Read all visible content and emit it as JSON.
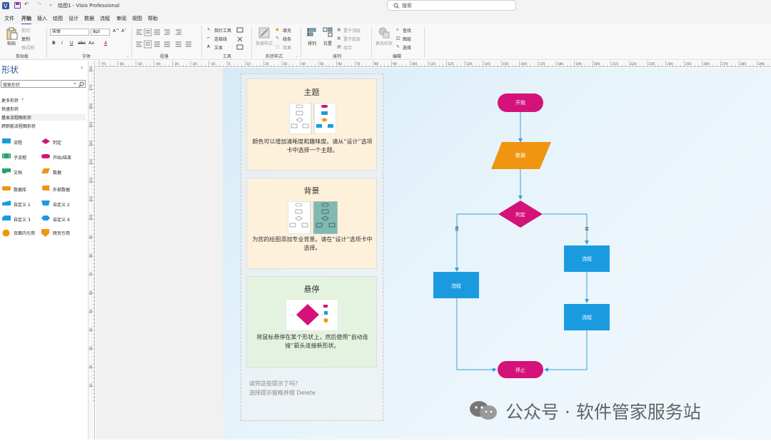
{
  "titlebar": {
    "title": "绘图1 - Visio Professional",
    "search_placeholder": "搜索"
  },
  "menu": {
    "tabs": [
      "文件",
      "开始",
      "插入",
      "绘图",
      "设计",
      "数据",
      "流程",
      "审阅",
      "视图",
      "帮助"
    ],
    "active_index": 1
  },
  "ribbon": {
    "clipboard": {
      "paste": "粘贴",
      "cut": "剪切",
      "copy": "复制",
      "format_painter": "格式刷",
      "group": "剪贴板"
    },
    "font": {
      "name": "宋体",
      "size": "8pt",
      "grow": "A^",
      "shrink": "A˅",
      "bold": "B",
      "italic": "I",
      "underline": "U",
      "strike": "abc",
      "case": "Aa",
      "color": "A",
      "group": "字体"
    },
    "paragraph": {
      "group": "段落"
    },
    "tools": {
      "pointer": "指针工具",
      "connector": "连接线",
      "text": "文本",
      "group": "工具"
    },
    "shape_styles": {
      "quick_styles": "快速样式",
      "fill": "填充",
      "line": "线条",
      "effects": "效果",
      "group": "形状样式"
    },
    "arrange": {
      "align": "排列",
      "position": "位置",
      "bring_front": "置于顶层",
      "send_back": "置于底层",
      "group_btn": "组合",
      "group": "排列"
    },
    "editing": {
      "change_shape": "更改形状",
      "find": "查找",
      "layers": "图层",
      "select": "选择",
      "group": "编辑"
    }
  },
  "left_panel": {
    "title": "形状",
    "search_placeholder": "搜索形状",
    "more_shapes": "更多形状",
    "quick_shapes": "快速形状",
    "basic_flowchart": "基本流程图形状",
    "cross_functional": "跨职能流程图形状",
    "stencils": [
      {
        "name": "流程",
        "icon": "process-shape-icon"
      },
      {
        "name": "判定",
        "icon": "decision-shape-icon"
      },
      {
        "name": "子流程",
        "icon": "subprocess-shape-icon"
      },
      {
        "name": "开始/结束",
        "icon": "terminator-shape-icon"
      },
      {
        "name": "文档",
        "icon": "document-shape-icon"
      },
      {
        "name": "数据",
        "icon": "data-shape-icon"
      },
      {
        "name": "数据库",
        "icon": "database-shape-icon"
      },
      {
        "name": "外部数据",
        "icon": "external-data-shape-icon"
      },
      {
        "name": "自定义 1",
        "icon": "custom1-shape-icon"
      },
      {
        "name": "自定义 2",
        "icon": "custom2-shape-icon"
      },
      {
        "name": "自定义 3",
        "icon": "custom3-shape-icon"
      },
      {
        "name": "自定义 4",
        "icon": "custom4-shape-icon"
      },
      {
        "name": "页面内引用",
        "icon": "on-page-ref-shape-icon"
      },
      {
        "name": "跨页引用",
        "icon": "off-page-ref-shape-icon"
      }
    ]
  },
  "hruler": {
    "ticks": [
      "-70",
      "-60",
      "-50",
      "-40",
      "-30",
      "-20",
      "-10",
      "0",
      "10",
      "20",
      "30",
      "40",
      "50",
      "60",
      "70",
      "80",
      "90",
      "100",
      "110",
      "120",
      "130",
      "140",
      "150",
      "160",
      "170",
      "180",
      "190",
      "200",
      "210",
      "220",
      "230",
      "240",
      "250",
      "260",
      "270",
      "280",
      "290"
    ]
  },
  "vruler": {
    "ticks": [
      "180",
      "170",
      "160",
      "150",
      "140",
      "130",
      "120",
      "110",
      "100",
      "90",
      "80",
      "70",
      "60",
      "50",
      "40",
      "30",
      "20",
      "10"
    ]
  },
  "tips": {
    "cards": [
      {
        "title": "主题",
        "text": "颜色可以增加清晰度和趣味度。请从“设计”选项卡中选择一个主题。",
        "bg": "#fdf1dc"
      },
      {
        "title": "背景",
        "text": "为您的绘图添加专业背景。请在“设计”选项卡中选择。",
        "bg": "#fdf1dc"
      },
      {
        "title": "悬停",
        "text": "将鼠标悬停在某个形状上，然后使用“自动连接”箭头连接新形状。",
        "bg": "#e3f3df"
      }
    ],
    "footer_question": "读完这些提示了吗?",
    "footer_hint": "选择提示窗格并按 Delete"
  },
  "flowchart": {
    "nodes": {
      "start": "开始",
      "data": "数据",
      "decision": "判定",
      "process_left": "流程",
      "process_right_1": "流程",
      "process_right_2": "流程",
      "end": "停止"
    },
    "edges": {
      "yes": "是",
      "no": "否"
    },
    "colors": {
      "terminator": "#d4127a",
      "data": "#f0950f",
      "process": "#1a9be0",
      "connector": "#3aa0d8"
    }
  },
  "watermark": "公众号 · 软件管家服务站"
}
